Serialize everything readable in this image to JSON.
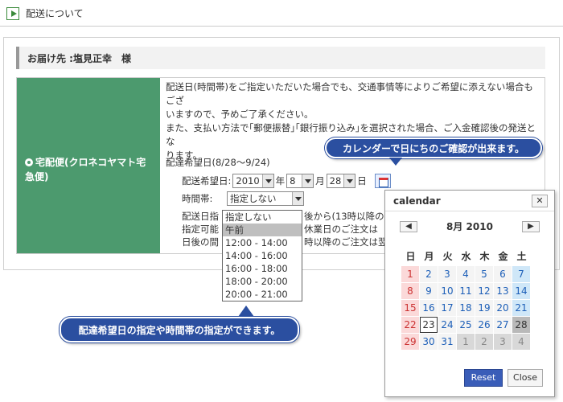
{
  "header": {
    "title": "配送について"
  },
  "recipient": "お届け先 :塩見正幸　様",
  "option": {
    "label": "宅配便(クロネコヤマト宅急便)"
  },
  "notice": {
    "l1": "配送日(時間帯)をご指定いただいた場合でも、交通事情等によりご希望に添えない場合もござ",
    "l2": "いますので、予めご了承ください。",
    "l3": "また、支払い方法で｢郵便振替｣｢銀行振り込み｣を選択された場合、ご入金確認後の発送とな",
    "l4": "ります。"
  },
  "delivery": {
    "heading": "配達希望日(8/28〜9/24)",
    "date_label": "配送希望日:",
    "year": "2010",
    "year_unit": "年",
    "month": "8",
    "month_unit": "月",
    "day": "28",
    "day_unit": "日",
    "time_label": "時間帯:",
    "time_value": "指定しない",
    "lines": [
      "配送日指",
      "指定可能",
      "日後の間"
    ],
    "lines_right": [
      "後から(13時以降のご",
      "休業日のご注文は",
      "時以降のご注文は翌"
    ]
  },
  "time_options": [
    "指定しない",
    "午前",
    "12:00 - 14:00",
    "14:00 - 16:00",
    "16:00 - 18:00",
    "18:00 - 20:00",
    "20:00 - 21:00"
  ],
  "callouts": {
    "calendar": "カレンダーで日にちのご確認が出来ます。",
    "dropdown": "配達希望日の指定や時間帯の指定ができます。"
  },
  "calendar": {
    "title": "calendar",
    "close_x": "✕",
    "prev": "◀",
    "next": "▶",
    "month_title": "8月 2010",
    "weekdays": [
      "日",
      "月",
      "火",
      "水",
      "木",
      "金",
      "土"
    ],
    "weeks": [
      [
        "1",
        "2",
        "3",
        "4",
        "5",
        "6",
        "7"
      ],
      [
        "8",
        "9",
        "10",
        "11",
        "12",
        "13",
        "14"
      ],
      [
        "15",
        "16",
        "17",
        "18",
        "19",
        "20",
        "21"
      ],
      [
        "22",
        "23",
        "24",
        "25",
        "26",
        "27",
        "28"
      ],
      [
        "29",
        "30",
        "31",
        "1",
        "2",
        "3",
        "4"
      ]
    ],
    "reset": "Reset",
    "close": "Close"
  }
}
